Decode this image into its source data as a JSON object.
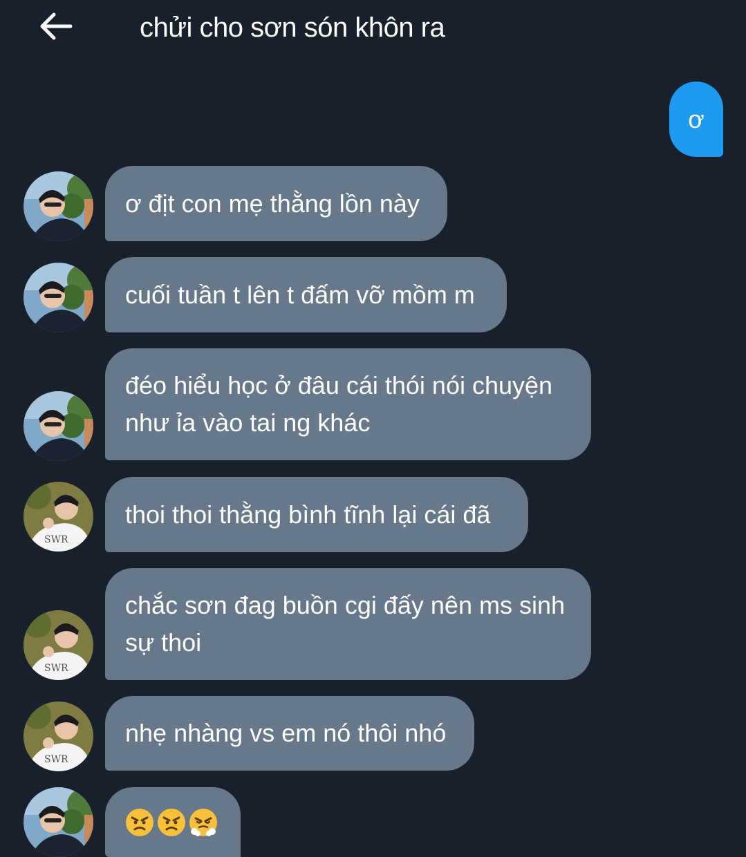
{
  "header": {
    "title": "chửi cho sơn són khôn ra",
    "back_icon": "arrow-left-icon"
  },
  "sent_message": {
    "text": "ơ"
  },
  "messages": [
    {
      "sender": "avatar-1",
      "text": "ơ địt con mẹ thằng lồn này"
    },
    {
      "sender": "avatar-1",
      "text": "cuối tuần t lên t đấm vỡ mồm m"
    },
    {
      "sender": "avatar-1",
      "text": "đéo hiểu học ở đâu cái thói nói chuyện như ỉa vào tai ng khác"
    },
    {
      "sender": "avatar-2",
      "text": "thoi thoi thằng bình tĩnh lại cái đã"
    },
    {
      "sender": "avatar-2",
      "text": "chắc sơn đag buồn cgi đấy nên ms sinh sự thoi"
    },
    {
      "sender": "avatar-2",
      "text": "nhẹ nhàng vs em nó thôi nhó"
    },
    {
      "sender": "avatar-1",
      "text": "",
      "emojis": [
        "angry-face",
        "angry-face",
        "face-with-steam"
      ]
    }
  ],
  "colors": {
    "background": "#17202b",
    "received_bubble": "#66788a",
    "sent_bubble": "#1d9bf0",
    "text": "#ffffff"
  }
}
